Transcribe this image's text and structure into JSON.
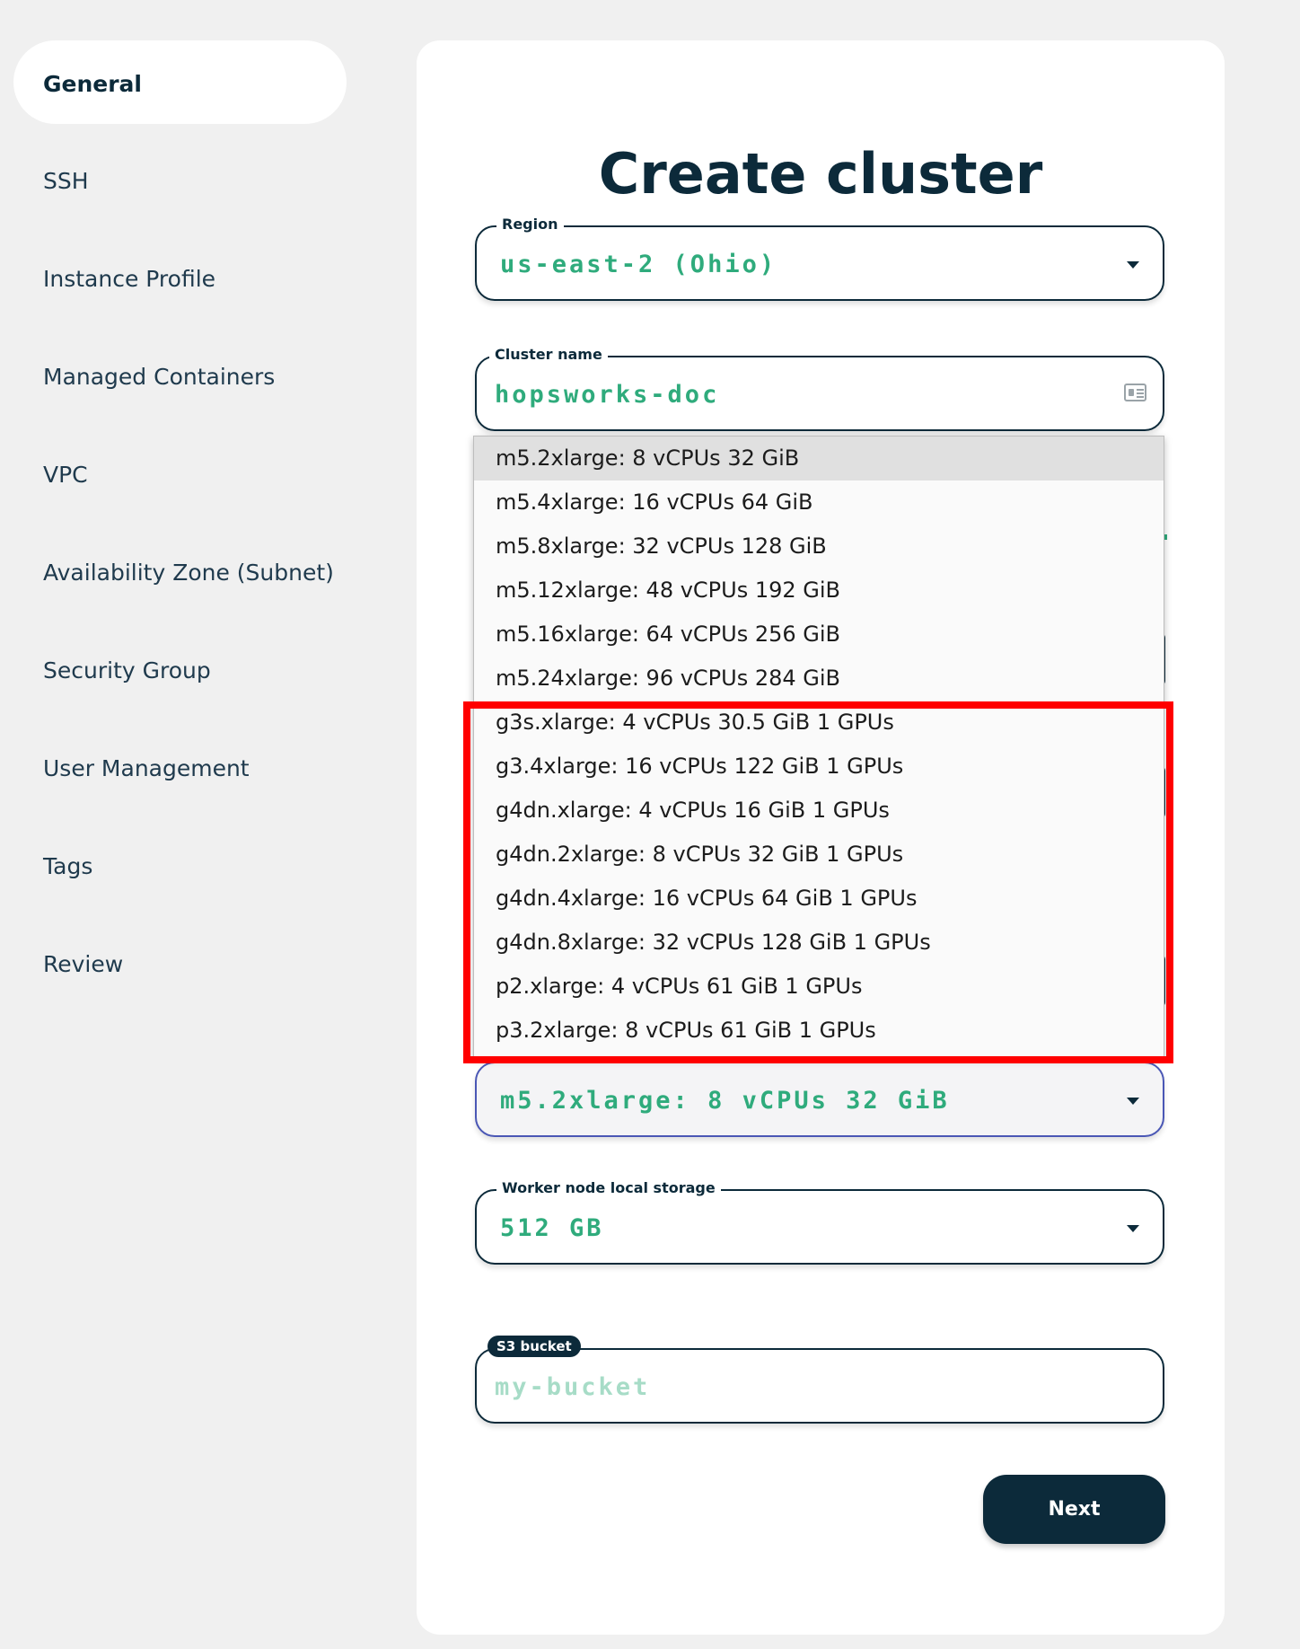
{
  "sidebar": {
    "items": [
      {
        "label": "General",
        "active": true
      },
      {
        "label": "SSH"
      },
      {
        "label": "Instance Profile"
      },
      {
        "label": "Managed Containers"
      },
      {
        "label": "VPC"
      },
      {
        "label": "Availability Zone (Subnet)"
      },
      {
        "label": "Security Group"
      },
      {
        "label": "User Management"
      },
      {
        "label": "Tags"
      },
      {
        "label": "Review"
      }
    ]
  },
  "form": {
    "title": "Create cluster",
    "region": {
      "label": "Region",
      "value": "us-east-2 (Ohio)"
    },
    "cluster_name": {
      "label": "Cluster name",
      "value": "hopsworks-doc"
    },
    "worker_type": {
      "value": "m5.2xlarge: 8 vCPUs 32 GiB"
    },
    "worker_storage": {
      "label": "Worker node local storage",
      "value": "512 GB"
    },
    "s3_bucket": {
      "label": "S3 bucket",
      "placeholder": "my-bucket"
    },
    "next_label": "Next"
  },
  "dropdown": {
    "options": [
      "m5.2xlarge: 8 vCPUs 32 GiB",
      "m5.4xlarge: 16 vCPUs 64 GiB",
      "m5.8xlarge: 32 vCPUs 128 GiB",
      "m5.12xlarge: 48 vCPUs 192 GiB",
      "m5.16xlarge: 64 vCPUs 256 GiB",
      "m5.24xlarge: 96 vCPUs 284 GiB",
      "g3s.xlarge: 4 vCPUs 30.5 GiB 1 GPUs",
      "g3.4xlarge: 16 vCPUs 122 GiB 1 GPUs",
      "g4dn.xlarge: 4 vCPUs 16 GiB 1 GPUs",
      "g4dn.2xlarge: 8 vCPUs 32 GiB 1 GPUs",
      "g4dn.4xlarge: 16 vCPUs 64 GiB 1 GPUs",
      "g4dn.8xlarge: 32 vCPUs 128 GiB 1 GPUs",
      "p2.xlarge: 4 vCPUs 61 GiB 1 GPUs",
      "p3.2xlarge: 8 vCPUs 61 GiB 1 GPUs"
    ],
    "highlighted_index": 0
  },
  "colors": {
    "primary": "#0c2a3a",
    "accent_green": "#2fab7c",
    "annotation_red": "#ff0000"
  }
}
